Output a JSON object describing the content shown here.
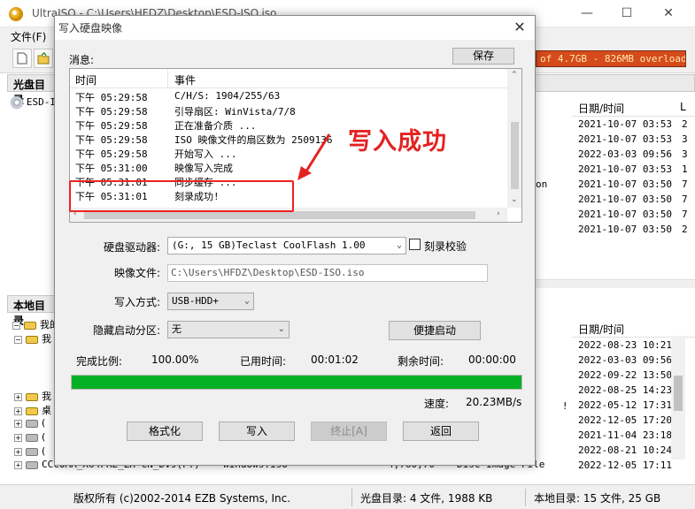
{
  "main_window": {
    "title": "UltraISO - C:\\Users\\HFDZ\\Desktop\\ESD-ISO.iso",
    "controls": {
      "minimize": "—",
      "maximize": "☐",
      "close": "✕"
    },
    "menu": [
      "文件(F)"
    ],
    "overload_banner": "of 4.7GB - 826MB overload",
    "cd_panel_header": "光盘目录",
    "cd_tree_item": "ESD-I",
    "local_panel_header": "本地目录",
    "right_top_columns": {
      "date": "日期/时间",
      "l": "L"
    },
    "right_top_rows": [
      {
        "date": "2021-10-07 03:53",
        "c2": "2"
      },
      {
        "date": "2021-10-07 03:53",
        "c2": "3"
      },
      {
        "date": "2022-03-03 09:56",
        "c2": "3"
      },
      {
        "date": "2021-10-07 03:53",
        "c2": "1"
      },
      {
        "date": "2021-10-07 03:50",
        "c2": "7"
      },
      {
        "date": "2021-10-07 03:50",
        "c2": "7"
      },
      {
        "date": "2021-10-07 03:50",
        "c2": "7"
      },
      {
        "date": "2021-10-07 03:50",
        "c2": "2"
      }
    ],
    "right_top_partial_text": "on",
    "right_bottom_column": "日期/时间",
    "right_bottom_rows": [
      "2022-08-23 10:21",
      "2022-03-03 09:56",
      "2022-09-22 13:50",
      "2022-08-25 14:23",
      "2022-05-12 17:31",
      "2022-12-05 17:20",
      "2021-11-04 23:18",
      "2022-08-21 10:24",
      "2022-12-05 17:11"
    ],
    "bottom_stray_mark": "!",
    "local_tree": [
      {
        "pm": "−",
        "label": "我的电"
      },
      {
        "pm": "−",
        "label": "我"
      },
      {
        "pm": "+",
        "label": "我"
      },
      {
        "pm": "+",
        "label": "桌"
      },
      {
        "pm": "+",
        "label": "("
      },
      {
        "pm": "+",
        "label": "("
      },
      {
        "pm": "+",
        "label": "("
      },
      {
        "pm": "+",
        "label": "CCCOMA_X64FRE_ZH-CN_DV9(F:)"
      }
    ],
    "bottom_list_row": {
      "name": "Windows.iso",
      "size": "4,760,70",
      "type": "Disc Image File"
    },
    "status": {
      "copyright": "版权所有 (c)2002-2014 EZB Systems, Inc.",
      "cd_dir": "光盘目录: 4 文件, 1988 KB",
      "local_dir": "本地目录: 15 文件, 25 GB"
    }
  },
  "dialog": {
    "title": "写入硬盘映像",
    "close": "✕",
    "messages_label": "消息:",
    "save_button": "保存",
    "log_columns": {
      "time": "时间",
      "event": "事件"
    },
    "log_rows": [
      {
        "time": "下午 05:29:58",
        "event": "C/H/S: 1904/255/63"
      },
      {
        "time": "下午 05:29:58",
        "event": "引导扇区: WinVista/7/8"
      },
      {
        "time": "下午 05:29:58",
        "event": "正在准备介质 ..."
      },
      {
        "time": "下午 05:29:58",
        "event": "ISO 映像文件的扇区数为 2509136"
      },
      {
        "time": "下午 05:29:58",
        "event": "开始写入 ..."
      },
      {
        "time": "下午 05:31:00",
        "event": "映像写入完成"
      },
      {
        "time": "下午 05:31:01",
        "event": "同步缓存 ..."
      },
      {
        "time": "下午 05:31:01",
        "event": "刻录成功!"
      }
    ],
    "annotation": "写入成功",
    "drive_label": "硬盘驱动器:",
    "drive_value": "(G:, 15 GB)Teclast CoolFlash     1.00",
    "verify_label": "刻录校验",
    "verify_checked": false,
    "image_file_label": "映像文件:",
    "image_file_value": "C:\\Users\\HFDZ\\Desktop\\ESD-ISO.iso",
    "write_method_label": "写入方式:",
    "write_method_value": "USB-HDD+",
    "hidden_partition_label": "隐藏启动分区:",
    "hidden_partition_value": "无",
    "quick_boot_button": "便捷启动",
    "completion_label": "完成比例:",
    "completion_value": "100.00%",
    "progress_fraction": 1.0,
    "elapsed_label": "已用时间:",
    "elapsed_value": "00:01:02",
    "remaining_label": "剩余时间:",
    "remaining_value": "00:00:00",
    "speed_label": "速度:",
    "speed_value": "20.23MB/s",
    "buttons": {
      "format": "格式化",
      "write": "写入",
      "stop": "终止[A]",
      "back": "返回"
    }
  },
  "colors": {
    "annotation_red": "#e32222",
    "progress_green": "#06b025",
    "overload_bg": "#d64b1b"
  }
}
